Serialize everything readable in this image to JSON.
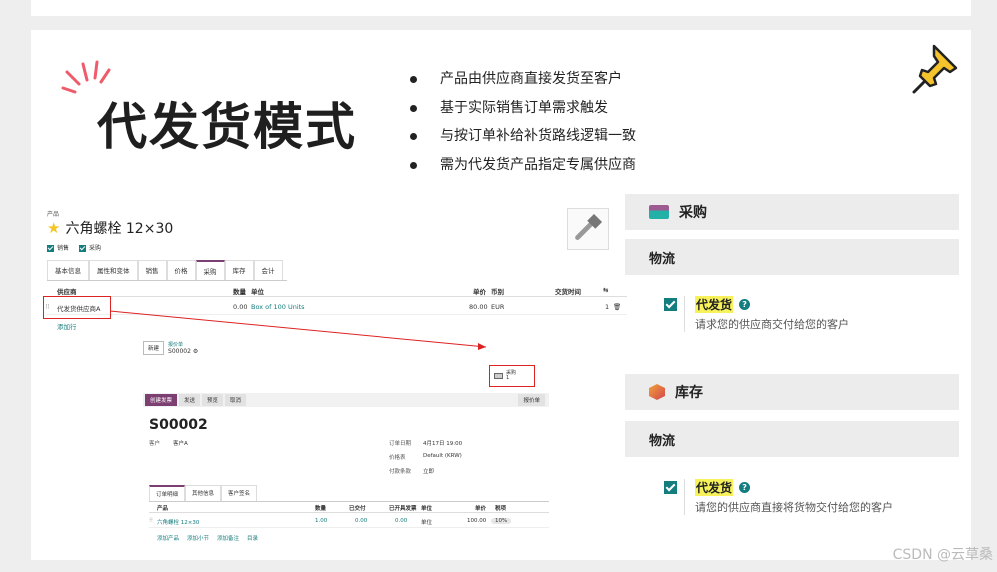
{
  "slide": {
    "title": "代发货模式",
    "bullets": [
      "产品由供应商直接发货至客户",
      "基于实际销售订单需求触发",
      "与按订单补给补货路线逻辑一致",
      "需为代发货产品指定专属供应商"
    ]
  },
  "product": {
    "label": "产品",
    "name": "六角螺栓 12×30",
    "checks": [
      "销售",
      "采购"
    ],
    "tabs": [
      "基本信息",
      "属性和变体",
      "销售",
      "价格",
      "采购",
      "库存",
      "会计"
    ],
    "vendor_headers": {
      "vendor": "供应商",
      "qty": "数量",
      "unit": "单位",
      "price": "单价",
      "currency": "币别",
      "lead": "交货时间"
    },
    "vendor_row": {
      "vendor": "代发货供应商A",
      "qty": "0.00",
      "unit": "Box of 100 Units",
      "price": "80.00",
      "currency": "EUR",
      "lead": "1"
    },
    "add_line": "添加行"
  },
  "sale_order": {
    "new_btn": "新建",
    "crumb_label": "报价单",
    "crumb_number": "S00002",
    "buy_label": "采购",
    "buy_count": "1",
    "actions": [
      "创建发票",
      "发送",
      "预览",
      "取消"
    ],
    "right_action": "报价单",
    "number": "S00002",
    "customer_label": "客户",
    "customer": "客户A",
    "order_date_label": "订单日期",
    "order_date": "4月17日 19:00",
    "pricelist_label": "价格表",
    "pricelist": "Default (KRW)",
    "payment_label": "付款条款",
    "payment": "立即",
    "tabs": [
      "订单明细",
      "其他信息",
      "客户签名"
    ],
    "line_headers": {
      "product": "产品",
      "qty": "数量",
      "delivered": "已交付",
      "invoiced": "已开具发票",
      "unit": "单位",
      "price": "单价",
      "tax": "税项"
    },
    "line": {
      "product": "六角螺栓 12×30",
      "qty": "1.00",
      "delivered": "0.00",
      "invoiced": "0.00",
      "unit": "单位",
      "price": "100.00",
      "tax": "10%"
    },
    "line_links": [
      "添加产品",
      "添加小节",
      "添加备注",
      "目录"
    ]
  },
  "settings": {
    "purchase": {
      "header": "采购",
      "section": "物流",
      "option_title": "代发货",
      "option_desc": "请求您的供应商交付给您的客户"
    },
    "inventory": {
      "header": "库存",
      "section": "物流",
      "option_title": "代发货",
      "option_desc": "请您的供应商直接将货物交付给您的客户"
    }
  },
  "watermark": "CSDN @云草桑",
  "colors": {
    "accent_teal": "#147d7e",
    "accent_purple": "#7c3f72",
    "highlight": "#f7f25a",
    "annotation_red": "#d22222"
  }
}
